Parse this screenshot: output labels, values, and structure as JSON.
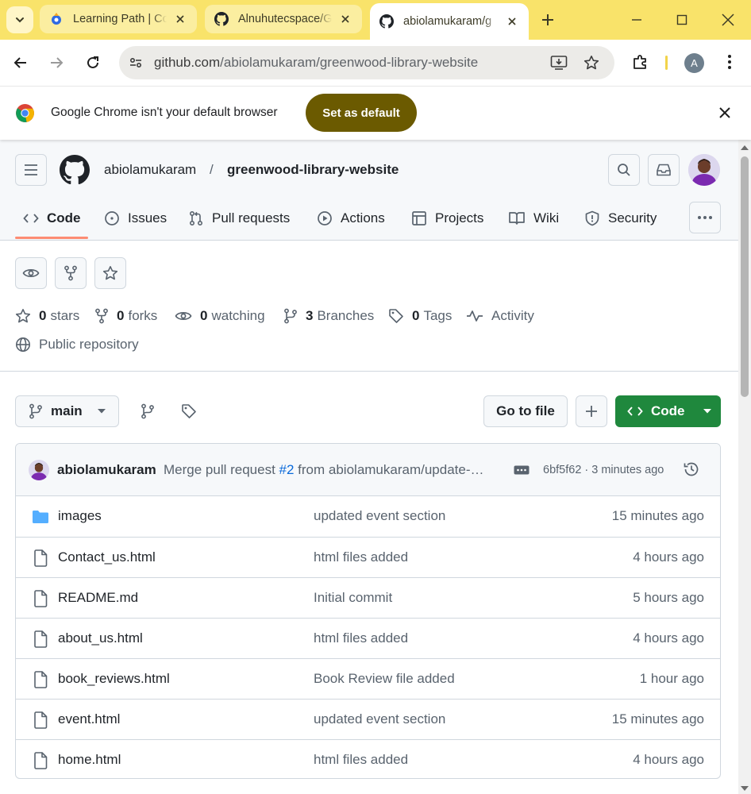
{
  "browser": {
    "tabs": [
      {
        "title": "Learning Path | Co",
        "favicon": "learning-path-icon",
        "active": false
      },
      {
        "title": "Alnuhutecspace/G",
        "favicon": "github-icon",
        "active": false
      },
      {
        "title": "abiolamukaram/g",
        "favicon": "github-icon",
        "active": true
      }
    ],
    "url_host": "github.com",
    "url_path": "/abiolamukaram/greenwood-library-website",
    "profile_initial": "A"
  },
  "infobar": {
    "message": "Google Chrome isn't your default browser",
    "button": "Set as default"
  },
  "repo": {
    "owner": "abiolamukaram",
    "separator": "/",
    "name": "greenwood-library-website",
    "nav": [
      {
        "label": "Code",
        "icon": "code-icon",
        "selected": true
      },
      {
        "label": "Issues",
        "icon": "issue-icon"
      },
      {
        "label": "Pull requests",
        "icon": "pull-request-icon"
      },
      {
        "label": "Actions",
        "icon": "play-icon"
      },
      {
        "label": "Projects",
        "icon": "table-icon"
      },
      {
        "label": "Wiki",
        "icon": "book-icon"
      },
      {
        "label": "Security",
        "icon": "shield-icon"
      }
    ],
    "stats": {
      "stars_count": "0",
      "stars_label": "stars",
      "forks_count": "0",
      "forks_label": "forks",
      "watching_count": "0",
      "watching_label": "watching",
      "branches_count": "3",
      "branches_label": "Branches",
      "tags_count": "0",
      "tags_label": "Tags",
      "activity_label": "Activity",
      "visibility": "Public repository"
    },
    "branch": "main",
    "go_to_file": "Go to file",
    "code_button": "Code",
    "latest_commit": {
      "author": "abiolamukaram",
      "message_prefix": "Merge pull request ",
      "pr": "#2",
      "message_suffix": " from abiolamukaram/update-…",
      "sha_time": "6bf5f62 · 3 minutes ago"
    },
    "files": [
      {
        "name": "images",
        "type": "folder",
        "message": "updated event section",
        "time": "15 minutes ago"
      },
      {
        "name": "Contact_us.html",
        "type": "file",
        "message": "html files added",
        "time": "4 hours ago"
      },
      {
        "name": "README.md",
        "type": "file",
        "message": "Initial commit",
        "time": "5 hours ago"
      },
      {
        "name": "about_us.html",
        "type": "file",
        "message": "html files added",
        "time": "4 hours ago"
      },
      {
        "name": "book_reviews.html",
        "type": "file",
        "message": "Book Review file added",
        "time": "1 hour ago"
      },
      {
        "name": "event.html",
        "type": "file",
        "message": "updated event section",
        "time": "15 minutes ago"
      },
      {
        "name": "home.html",
        "type": "file",
        "message": "html files added",
        "time": "4 hours ago"
      }
    ]
  },
  "colors": {
    "tabstrip": "#f9e36a",
    "set_default_button": "#6b5a00",
    "code_button": "#1f883d",
    "selected_tab_underline": "#fd8c73",
    "link": "#0969da",
    "folder": "#54aeff"
  }
}
